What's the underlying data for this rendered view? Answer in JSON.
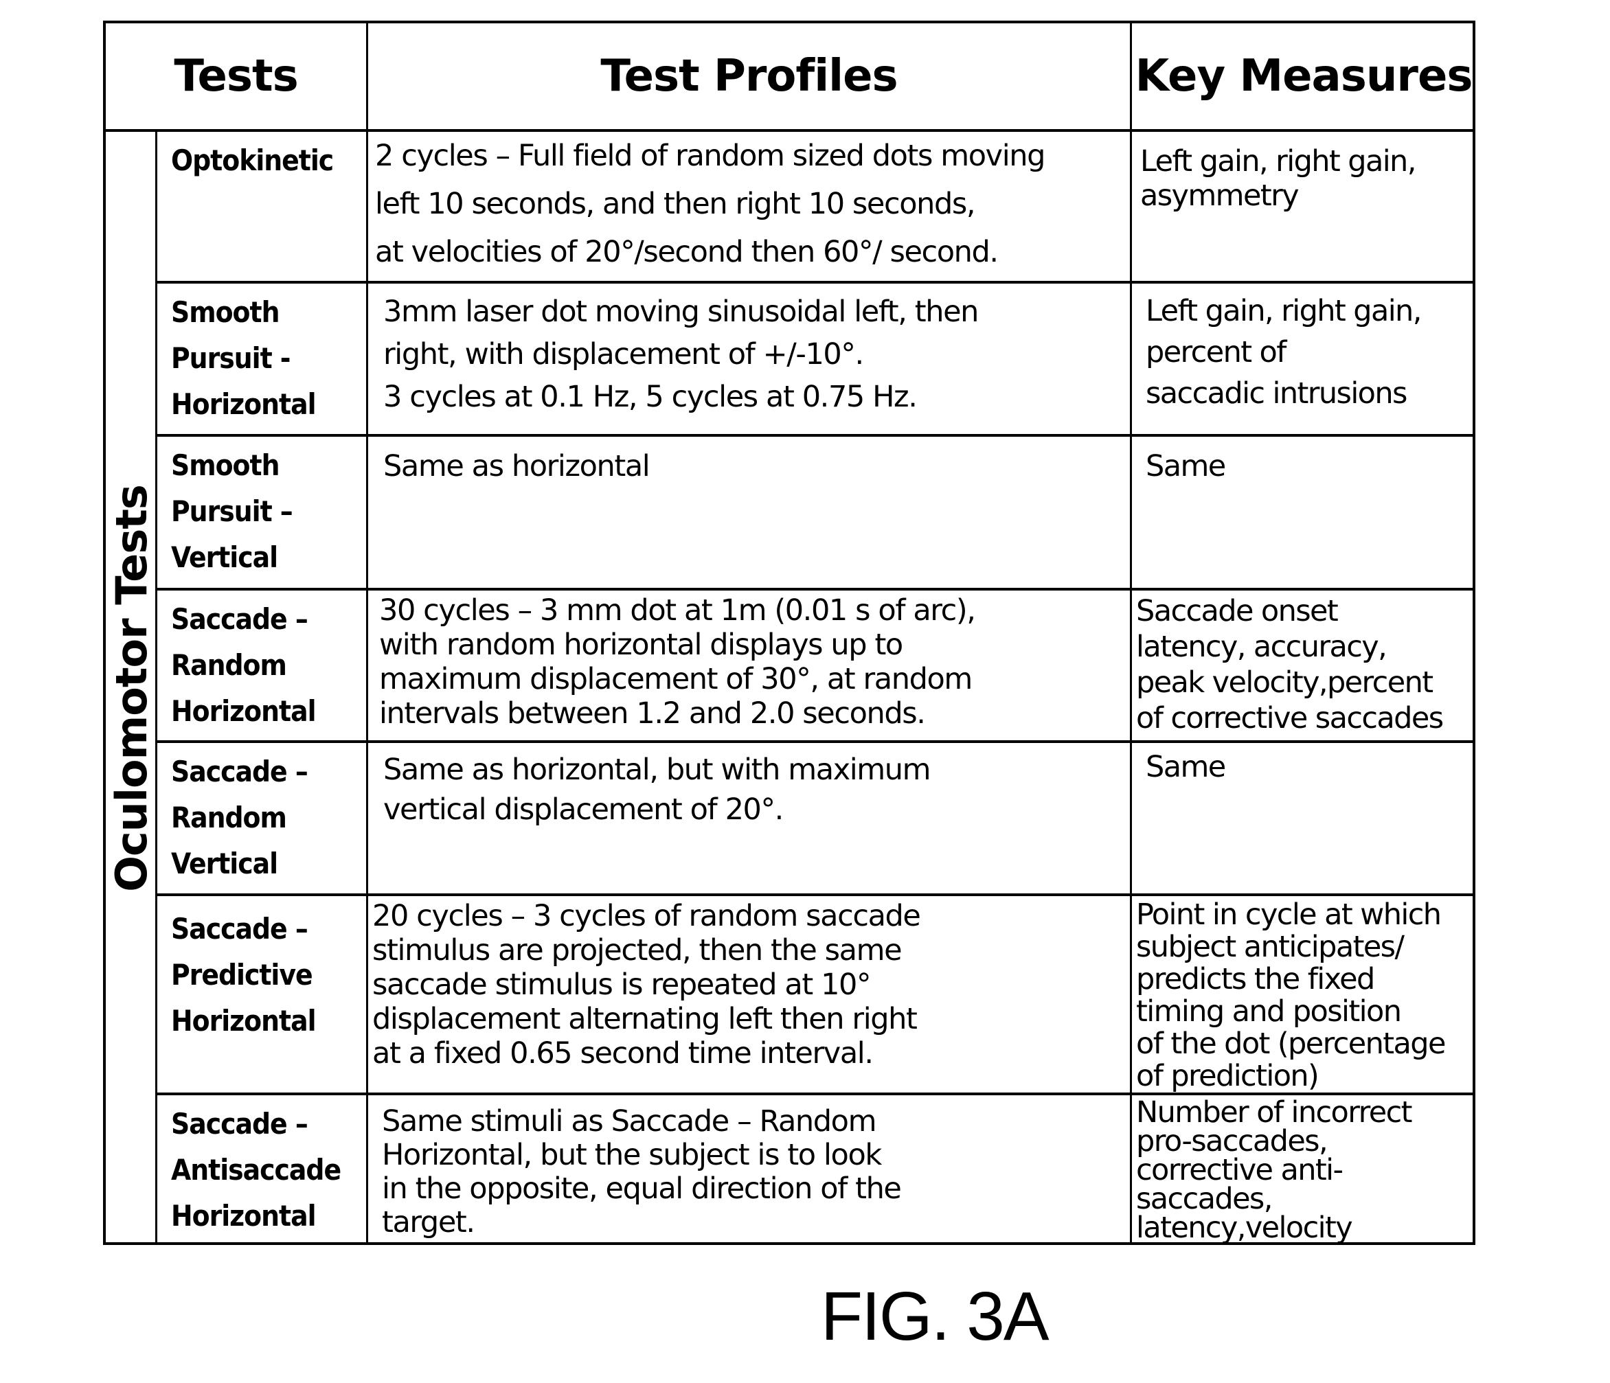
{
  "header": {
    "tests": "Tests",
    "test_profiles": "Test Profiles",
    "key_measures": "Key Measures"
  },
  "group_label": "Oculomotor Tests",
  "rows": [
    {
      "name": "Optokinetic",
      "profile": "2 cycles – Full field of random sized dots moving\nleft 10  seconds, and then right 10 seconds,\nat  velocities of 20°/second then 60°/ second.",
      "measures": "Left gain, right gain,\nasymmetry"
    },
    {
      "name": "Smooth\nPursuit -\nHorizontal",
      "profile": "3mm laser dot moving sinusoidal left, then\nright, with  displacement of +/-10°.\n3 cycles at 0.1 Hz, 5 cycles at 0.75  Hz.",
      "measures": "Left gain, right gain,\npercent of\nsaccadic intrusions"
    },
    {
      "name": "Smooth\nPursuit –\nVertical",
      "profile": "Same as horizontal",
      "measures": "Same"
    },
    {
      "name": "Saccade –\nRandom\nHorizontal",
      "profile": "30 cycles – 3 mm dot at 1m (0.01 s of arc),\nwith random  horizontal displays up to\nmaximum displacement of 30°, at  random\nintervals between 1.2 and 2.0 seconds.",
      "measures": "Saccade onset\nlatency, accuracy,\npeak velocity,percent\nof corrective saccades"
    },
    {
      "name": "Saccade –\nRandom\nVertical",
      "profile": "Same as horizontal, but with maximum\nvertical  displacement of 20°.",
      "measures": "Same"
    },
    {
      "name": "Saccade –\nPredictive\nHorizontal",
      "profile": "20 cycles – 3 cycles of random saccade\nstimulus are  projected, then the same\nsaccade stimulus is repeated at  10°\ndisplacement alternating left then right\nat a fixed 0.65  second time interval.",
      "measures": "Point in cycle at which\nsubject   anticipates/\npredicts the fixed\ntiming and position\nof the dot (percentage\nof prediction)"
    },
    {
      "name": "Saccade –\nAntisaccade\nHorizontal",
      "profile": "Same stimuli as Saccade – Random\nHorizontal, but the  subject is to look\nin the opposite, equal direction of the\ntarget.",
      "measures": "Number of incorrect\npro-saccades,\ncorrective anti-\nsaccades,\nlatency,velocity"
    }
  ],
  "figure_label": "FIG. 3A"
}
